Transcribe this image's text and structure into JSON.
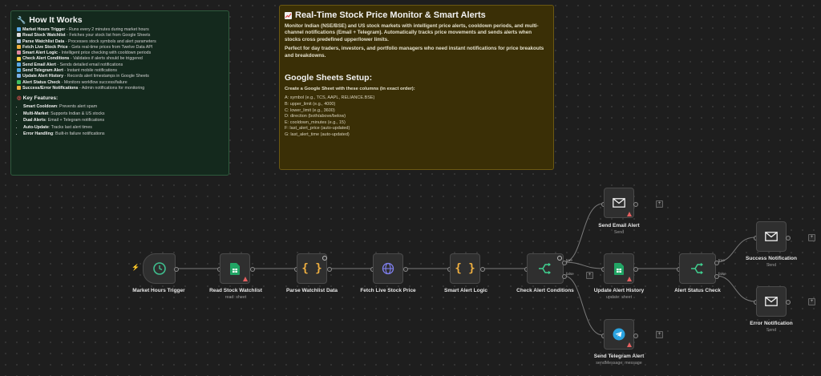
{
  "how_it_works": {
    "title": "How It Works",
    "items": [
      {
        "name": "Market Hours Trigger",
        "desc": " - Runs every 2 minutes during market hours",
        "color": "#5aa9e6"
      },
      {
        "name": "Read Stock Watchlist",
        "desc": " - Fetches your stock list from Google Sheets",
        "color": "#e0e0e0"
      },
      {
        "name": "Parse Watchlist Data",
        "desc": " - Processes stock symbols and alert parameters",
        "color": "#9fb8d8"
      },
      {
        "name": "Fetch Live Stock Price",
        "desc": " - Gets real-time prices from Twelve Data API",
        "color": "#f0b040"
      },
      {
        "name": "Smart Alert Logic",
        "desc": " - Intelligent price checking with cooldown periods",
        "color": "#e08aa0"
      },
      {
        "name": "Check Alert Conditions",
        "desc": " - Validates if alerts should be triggered",
        "color": "#f5d040"
      },
      {
        "name": "Send Email Alert",
        "desc": " - Sends detailed email notifications",
        "color": "#5aa9e6"
      },
      {
        "name": "Send Telegram Alert",
        "desc": " - Instant mobile notifications",
        "color": "#4aa8e0"
      },
      {
        "name": "Update Alert History",
        "desc": " - Records alert timestamps in Google Sheets",
        "color": "#7ab0e8"
      },
      {
        "name": "Alert Status Check",
        "desc": " - Monitors workflow success/failure",
        "color": "#40c060"
      },
      {
        "name": "Success/Error Notifications",
        "desc": " - Admin notifications for monitoring",
        "color": "#f0b040"
      }
    ],
    "features_title": "Key Features:",
    "features": [
      {
        "name": "Smart Cooldown",
        "desc": ": Prevents alert spam"
      },
      {
        "name": "Multi-Market",
        "desc": ": Supports Indian & US stocks"
      },
      {
        "name": "Dual Alerts",
        "desc": ": Email + Telegram notifications"
      },
      {
        "name": "Auto-Update",
        "desc": ": Tracks last alert times"
      },
      {
        "name": "Error Handling",
        "desc": ": Built-in failure notifications"
      }
    ]
  },
  "monitor_note": {
    "title": "Real-Time Stock Price Monitor & Smart Alerts",
    "para1": "Monitor Indian (NSE/BSE) and US stock markets with intelligent price alerts, cooldown periods, and multi-channel notifications (Email + Telegram). Automatically tracks price movements and sends alerts when stocks cross predefined upper/lower limits.",
    "para2": "Perfect for day traders, investors, and portfolio managers who need instant notifications for price breakouts and breakdowns.",
    "setup_title": "Google Sheets Setup:",
    "setup_intro": "Create a Google Sheet with these columns (in exact order):",
    "columns": [
      "A: symbol (e.g., TCS, AAPL, RELIANCE.BSE)",
      "B: upper_limit (e.g., 4000)",
      "C: lower_limit (e.g., 3600)",
      "D: direction (both/above/below)",
      "E: cooldown_minutes (e.g., 15)",
      "F: last_alert_price (auto-updated)",
      "G: last_alert_time (auto-updated)"
    ]
  },
  "nodes": {
    "trigger": {
      "label": "Market Hours Trigger"
    },
    "read_sheet": {
      "label": "Read Stock Watchlist",
      "sub": "read: sheet"
    },
    "parse": {
      "label": "Parse Watchlist Data"
    },
    "fetch": {
      "label": "Fetch Live Stock Price"
    },
    "smart": {
      "label": "Smart Alert Logic"
    },
    "check": {
      "label": "Check Alert Conditions",
      "true_label": "true",
      "false_label": "false"
    },
    "email": {
      "label": "Send Email Alert",
      "sub": "Send"
    },
    "update": {
      "label": "Update Alert History",
      "sub": "update: sheet"
    },
    "telegram": {
      "label": "Send Telegram Alert",
      "sub": "sendMessage: message"
    },
    "status": {
      "label": "Alert Status Check",
      "true_label": "true",
      "false_label": "false"
    },
    "success": {
      "label": "Success Notification",
      "sub": "Send"
    },
    "error": {
      "label": "Error Notification",
      "sub": "Send"
    }
  }
}
